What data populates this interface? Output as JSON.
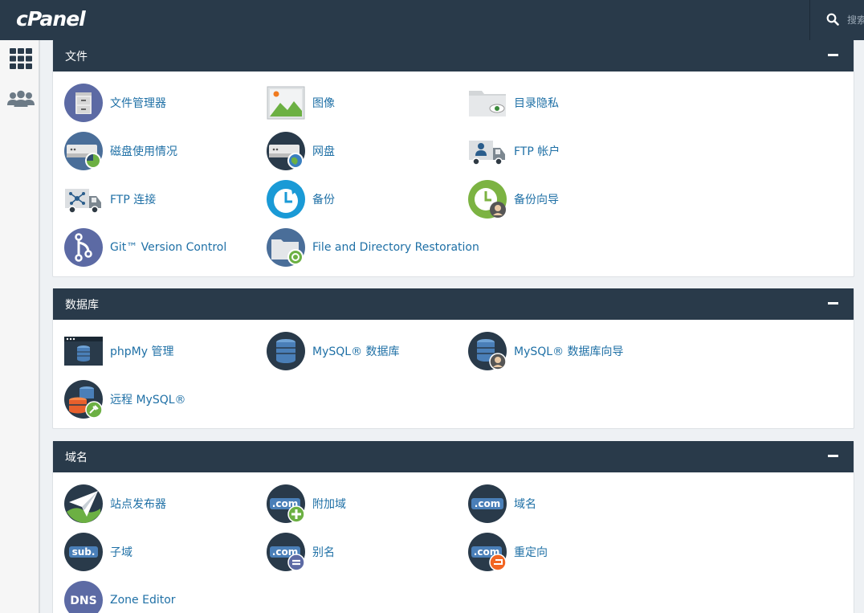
{
  "brand": {
    "logo_text": "cPanel"
  },
  "search": {
    "placeholder": "搜索"
  },
  "sidebar": {
    "items": [
      {
        "icon": "grid-icon"
      },
      {
        "icon": "users-icon"
      }
    ]
  },
  "colors": {
    "header_bg": "#293a4a",
    "link": "#1f70a6",
    "page_bg": "#eef1f4"
  },
  "sections": [
    {
      "title": "文件",
      "items": [
        {
          "label": "文件管理器",
          "icon": "file-cabinet-icon"
        },
        {
          "label": "图像",
          "icon": "image-icon"
        },
        {
          "label": "目录隐私",
          "icon": "folder-eye-icon"
        },
        {
          "label": "磁盘使用情况",
          "icon": "disk-usage-icon"
        },
        {
          "label": "网盘",
          "icon": "web-disk-icon"
        },
        {
          "label": "FTP 帐户",
          "icon": "ftp-account-icon"
        },
        {
          "label": "FTP 连接",
          "icon": "ftp-connection-icon"
        },
        {
          "label": "备份",
          "icon": "backup-icon"
        },
        {
          "label": "备份向导",
          "icon": "backup-wizard-icon"
        },
        {
          "label": "Git™ Version Control",
          "icon": "git-icon"
        },
        {
          "label": "File and Directory Restoration",
          "icon": "folder-restore-icon"
        }
      ]
    },
    {
      "title": "数据库",
      "items": [
        {
          "label": "phpMy 管理",
          "icon": "phpmyadmin-icon"
        },
        {
          "label": "MySQL® 数据库",
          "icon": "mysql-database-icon"
        },
        {
          "label": "MySQL® 数据库向导",
          "icon": "mysql-wizard-icon"
        },
        {
          "label": "远程 MySQL®",
          "icon": "remote-mysql-icon"
        }
      ]
    },
    {
      "title": "域名",
      "items": [
        {
          "label": "站点发布器",
          "icon": "site-publisher-icon"
        },
        {
          "label": "附加域",
          "icon": "addon-domain-icon"
        },
        {
          "label": "域名",
          "icon": "domains-icon"
        },
        {
          "label": "子域",
          "icon": "subdomain-icon"
        },
        {
          "label": "别名",
          "icon": "alias-icon"
        },
        {
          "label": "重定向",
          "icon": "redirect-icon"
        },
        {
          "label": "Zone Editor",
          "icon": "dns-zone-icon"
        }
      ]
    }
  ]
}
